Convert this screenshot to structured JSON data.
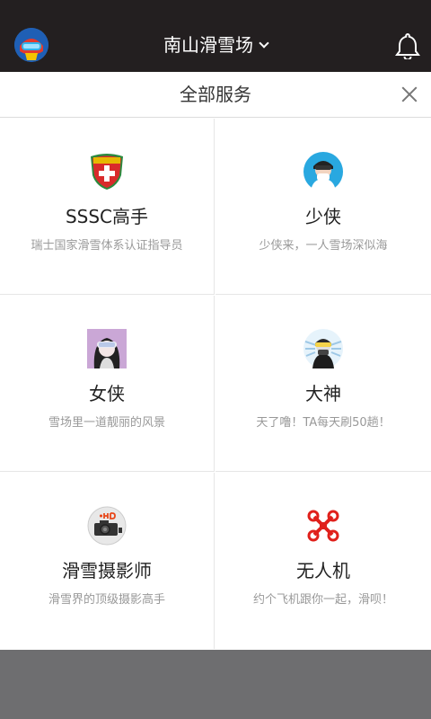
{
  "header": {
    "title": "南山滑雪场",
    "avatar_icon": "helmet-avatar-icon",
    "dropdown_icon": "chevron-down-icon",
    "bell_icon": "bell-icon"
  },
  "panel": {
    "title": "全部服务",
    "close_icon": "close-icon"
  },
  "services": [
    {
      "name": "SSSC高手",
      "desc": "瑞士国家滑雪体系认证指导员",
      "icon": "swiss-shield-icon"
    },
    {
      "name": "少侠",
      "desc": "少侠来，一人雪场深似海",
      "icon": "young-skier-avatar-icon"
    },
    {
      "name": "女侠",
      "desc": "雪场里一道靓丽的风景",
      "icon": "female-skier-avatar-icon"
    },
    {
      "name": "大神",
      "desc": "天了噜！TA每天刷50趟！",
      "icon": "master-skier-avatar-icon"
    },
    {
      "name": "滑雪摄影师",
      "desc": "滑雪界的顶级摄影高手",
      "icon": "camera-hd-icon"
    },
    {
      "name": "无人机",
      "desc": "约个飞机跟你一起，滑呗！",
      "icon": "drone-icon"
    }
  ],
  "colors": {
    "topbar": "#231f20",
    "overlay": "#6e6e70",
    "drone": "#e0201b"
  }
}
